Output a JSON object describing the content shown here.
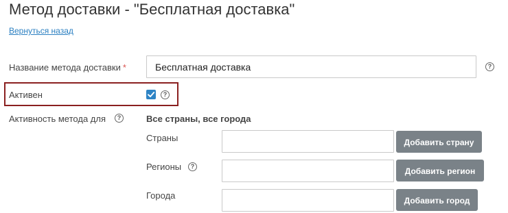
{
  "header": {
    "title": "Метод доставки - \"Бесплатная доставка\"",
    "back_link": "Вернуться назад"
  },
  "form": {
    "name_label": "Название метода доставки",
    "required_mark": "*",
    "name_value": "Бесплатная доставка",
    "active_label": "Активен",
    "active_checked": true,
    "scope_label": "Активность метода для",
    "scope_summary": "Все страны, все города",
    "countries_label": "Страны",
    "countries_value": "",
    "add_country_button": "Добавить страну",
    "regions_label": "Регионы",
    "regions_value": "",
    "add_region_button": "Добавить регион",
    "cities_label": "Города",
    "cities_value": "",
    "add_city_button": "Добавить город"
  },
  "colors": {
    "accent": "#2e84c5",
    "highlight_border": "#8a1f1f",
    "button_bg": "#7a8288",
    "link": "#2a7fc1",
    "required": "#d9534f"
  },
  "icons": {
    "help": "question-circle-icon",
    "check": "checkmark-icon"
  }
}
